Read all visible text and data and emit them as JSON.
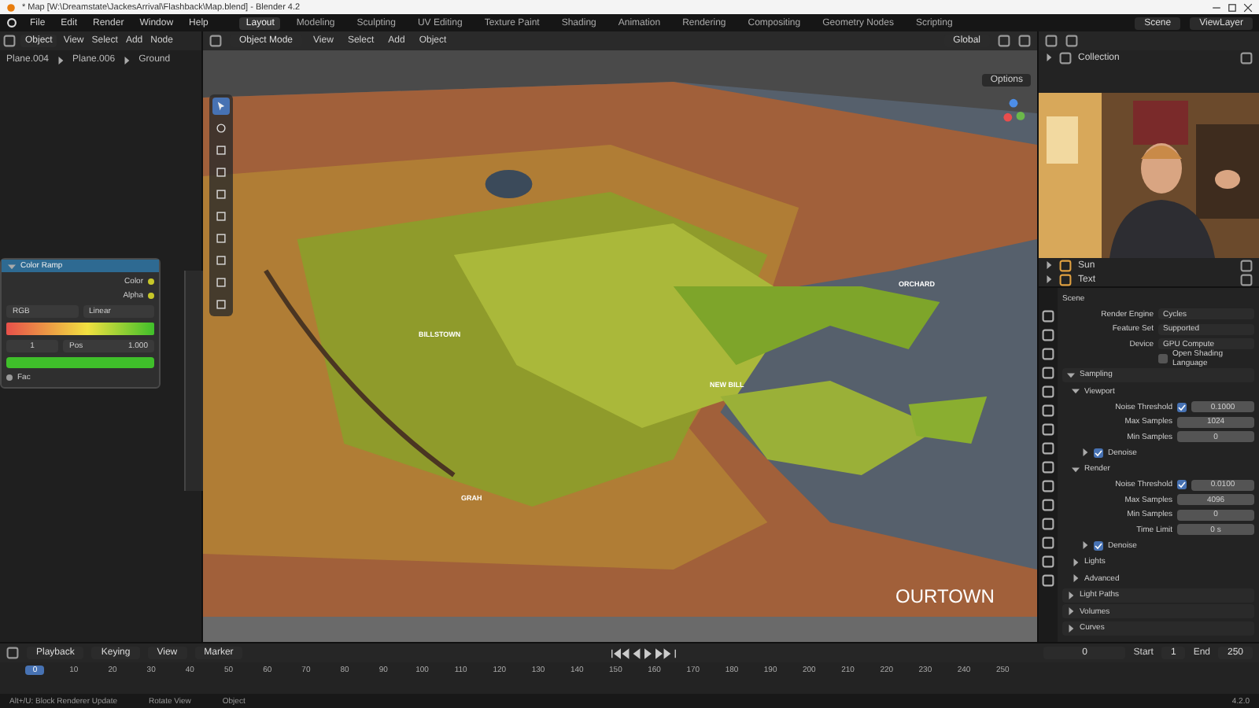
{
  "window": {
    "title": "* Map [W:\\Dreamstate\\JackesArrival\\Flashback\\Map.blend] - Blender 4.2"
  },
  "menu": [
    "File",
    "Edit",
    "Render",
    "Window",
    "Help"
  ],
  "workspaces": [
    {
      "label": "Layout",
      "selected": true
    },
    {
      "label": "Modeling",
      "selected": false
    },
    {
      "label": "Sculpting",
      "selected": false
    },
    {
      "label": "UV Editing",
      "selected": false
    },
    {
      "label": "Texture Paint",
      "selected": false
    },
    {
      "label": "Shading",
      "selected": false
    },
    {
      "label": "Animation",
      "selected": false
    },
    {
      "label": "Rendering",
      "selected": false
    },
    {
      "label": "Compositing",
      "selected": false
    },
    {
      "label": "Geometry Nodes",
      "selected": false
    },
    {
      "label": "Scripting",
      "selected": false
    }
  ],
  "scene_field": "Scene",
  "view_layer_field": "ViewLayer",
  "node_editor": {
    "mode": "Object",
    "menus": [
      "View",
      "Select",
      "Add",
      "Node"
    ],
    "breadcrumb": [
      "Plane.004",
      "Plane.006",
      "Ground"
    ],
    "node": {
      "title": "Color Ramp",
      "outputs": [
        "Color",
        "Alpha"
      ],
      "color_mode": "RGB",
      "interpolation": "Linear",
      "stop_index": "1",
      "pos_label": "Pos",
      "pos_value": "1.000",
      "input": "Fac"
    }
  },
  "viewport": {
    "mode": "Object Mode",
    "menus": [
      "View",
      "Select",
      "Add",
      "Object"
    ],
    "orientation": "Global",
    "options": "Options",
    "labels": [
      "BILLSTOWN",
      "ORCHARD",
      "NEW BILL",
      "GRAH",
      "OURTOWN"
    ]
  },
  "outliner": {
    "rows": [
      {
        "label": "Collection"
      }
    ],
    "bottom_rows": [
      {
        "label": "Sun"
      },
      {
        "label": "Text"
      }
    ]
  },
  "properties": {
    "context": "Scene",
    "rows": [
      {
        "kind": "select",
        "label": "Render Engine",
        "value": "Cycles"
      },
      {
        "kind": "select",
        "label": "Feature Set",
        "value": "Supported"
      },
      {
        "kind": "select",
        "label": "Device",
        "value": "GPU Compute"
      },
      {
        "kind": "check",
        "label": "Open Shading Language",
        "checked": false
      },
      {
        "kind": "panel",
        "label": "Sampling",
        "expanded": true,
        "children": [
          {
            "kind": "panel",
            "label": "Viewport",
            "expanded": true,
            "children": [
              {
                "kind": "field",
                "label": "Noise Threshold",
                "value": "0.1000",
                "checked": true
              },
              {
                "kind": "field",
                "label": "Max Samples",
                "value": "1024"
              },
              {
                "kind": "field",
                "label": "Min Samples",
                "value": "0"
              },
              {
                "kind": "panel",
                "label": "Denoise",
                "expanded": false,
                "checked": true
              }
            ]
          },
          {
            "kind": "panel",
            "label": "Render",
            "expanded": true,
            "children": [
              {
                "kind": "field",
                "label": "Noise Threshold",
                "value": "0.0100",
                "checked": true
              },
              {
                "kind": "field",
                "label": "Max Samples",
                "value": "4096"
              },
              {
                "kind": "field",
                "label": "Min Samples",
                "value": "0"
              },
              {
                "kind": "field",
                "label": "Time Limit",
                "value": "0 s"
              },
              {
                "kind": "panel",
                "label": "Denoise",
                "expanded": false,
                "checked": true
              }
            ]
          },
          {
            "kind": "panel",
            "label": "Lights",
            "expanded": false
          },
          {
            "kind": "panel",
            "label": "Advanced",
            "expanded": false
          }
        ]
      },
      {
        "kind": "panel",
        "label": "Light Paths",
        "expanded": false
      },
      {
        "kind": "panel",
        "label": "Volumes",
        "expanded": false
      },
      {
        "kind": "panel",
        "label": "Curves",
        "expanded": false
      }
    ]
  },
  "timeline": {
    "menus": [
      "Playback",
      "Keying",
      "View",
      "Marker"
    ],
    "current_frame": "0",
    "start_label": "Start",
    "start": "1",
    "end_label": "End",
    "end": "250",
    "ticks": [
      {
        "label": "0",
        "selected": true
      },
      {
        "label": "10",
        "selected": false
      },
      {
        "label": "20",
        "selected": false
      },
      {
        "label": "30",
        "selected": false
      },
      {
        "label": "40",
        "selected": false
      },
      {
        "label": "50",
        "selected": false
      },
      {
        "label": "60",
        "selected": false
      },
      {
        "label": "70",
        "selected": false
      },
      {
        "label": "80",
        "selected": false
      },
      {
        "label": "90",
        "selected": false
      },
      {
        "label": "100",
        "selected": false
      },
      {
        "label": "110",
        "selected": false
      },
      {
        "label": "120",
        "selected": false
      },
      {
        "label": "130",
        "selected": false
      },
      {
        "label": "140",
        "selected": false
      },
      {
        "label": "150",
        "selected": false
      },
      {
        "label": "160",
        "selected": false
      },
      {
        "label": "170",
        "selected": false
      },
      {
        "label": "180",
        "selected": false
      },
      {
        "label": "190",
        "selected": false
      },
      {
        "label": "200",
        "selected": false
      },
      {
        "label": "210",
        "selected": false
      },
      {
        "label": "220",
        "selected": false
      },
      {
        "label": "230",
        "selected": false
      },
      {
        "label": "240",
        "selected": false
      },
      {
        "label": "250",
        "selected": false
      }
    ]
  },
  "status_bar": {
    "items": [
      "Alt+/U: Block Renderer Update",
      "Rotate View",
      "Object"
    ],
    "version": "4.2.0"
  }
}
